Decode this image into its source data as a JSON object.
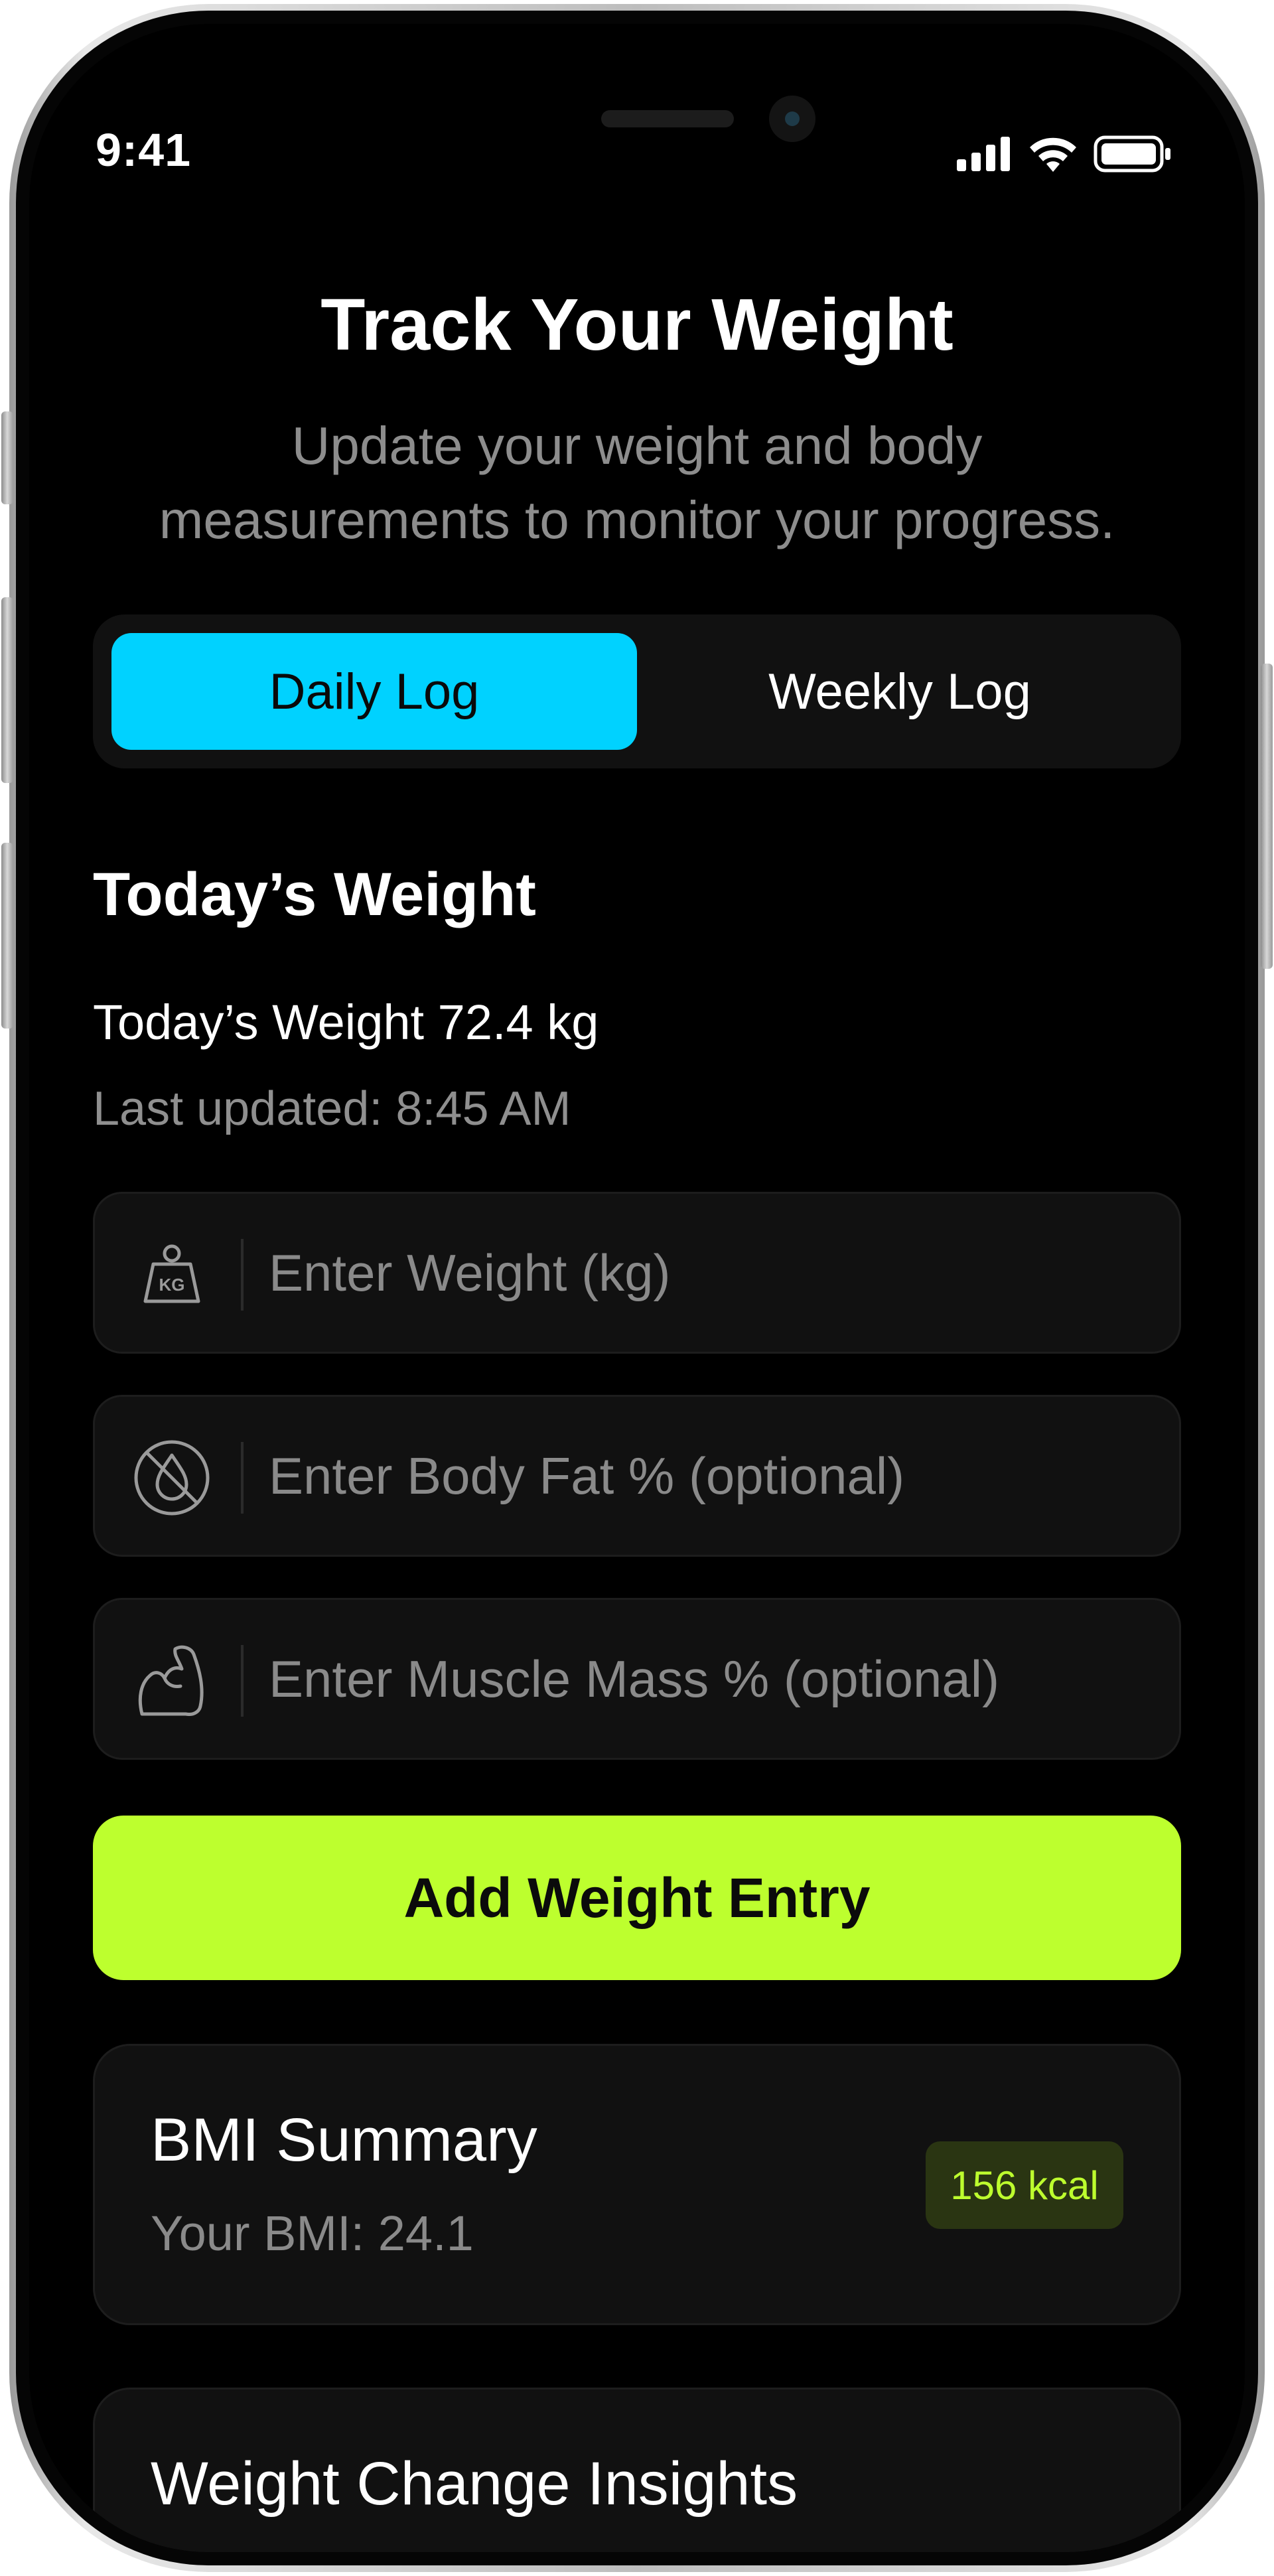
{
  "status_bar": {
    "time": "9:41",
    "icons": [
      "signal-icon",
      "wifi-icon",
      "battery-icon"
    ]
  },
  "header": {
    "title": "Track Your Weight",
    "subtitle": "Update your weight and body measurements to monitor your progress."
  },
  "tabs": [
    {
      "label": "Daily Log",
      "active": true
    },
    {
      "label": "Weekly Log",
      "active": false
    }
  ],
  "today": {
    "section_title": "Today’s Weight",
    "current": "Today’s Weight 72.4 kg",
    "last_updated": "Last updated: 8:45 AM"
  },
  "form": {
    "weight_placeholder": "Enter Weight (kg)",
    "weight_icon": "kg-weight-icon",
    "body_fat_placeholder": "Enter Body Fat % (optional)",
    "body_fat_icon": "water-drop-icon",
    "muscle_placeholder": "Enter Muscle Mass % (optional)",
    "muscle_icon": "flexed-bicep-icon",
    "submit_label": "Add Weight Entry"
  },
  "bmi": {
    "title": "BMI Summary",
    "value": "Your BMI: 24.1",
    "badge": "156 kcal"
  },
  "insights": {
    "title": "Weight Change Insights"
  },
  "colors": {
    "background": "#000000",
    "tab_active": "#00d2ff",
    "accent_green": "#bdff2e",
    "card": "#111111",
    "muted_text": "#8d8d8d"
  }
}
